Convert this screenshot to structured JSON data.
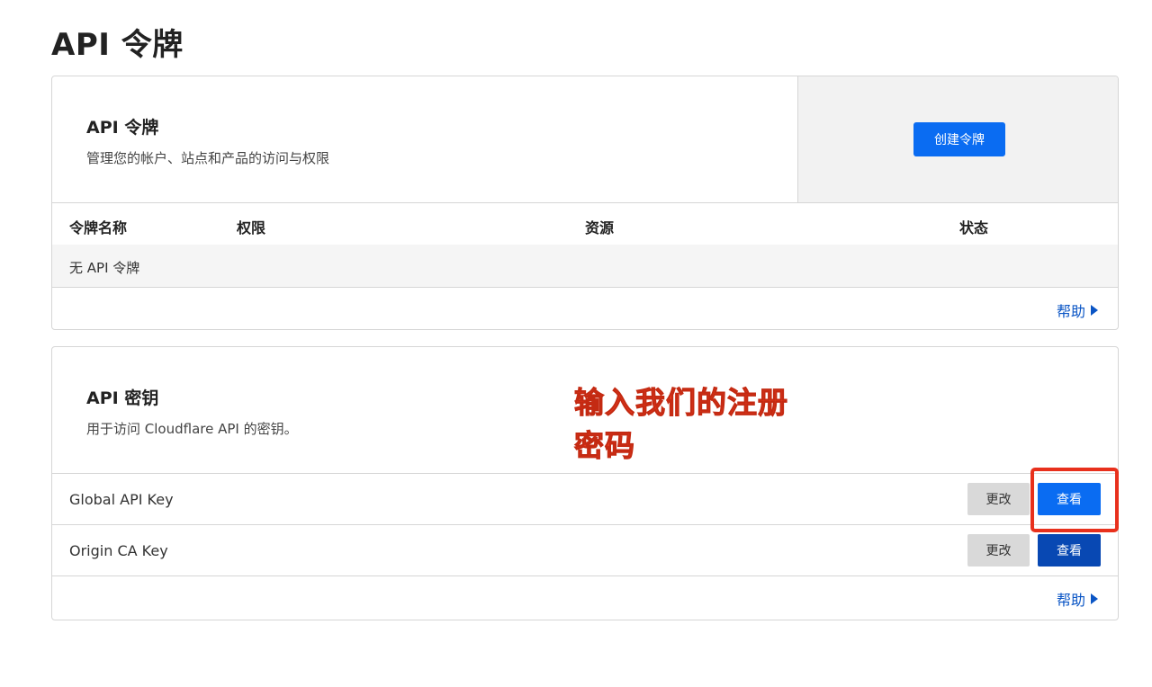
{
  "page": {
    "title": "API 令牌"
  },
  "tokens": {
    "heading": "API 令牌",
    "description": "管理您的帐户、站点和产品的访问与权限",
    "create_button": "创建令牌",
    "columns": [
      "令牌名称",
      "权限",
      "资源",
      "状态"
    ],
    "empty_message": "无 API 令牌",
    "help_link": "帮助"
  },
  "keys": {
    "heading": "API 密钥",
    "description": "用于访问 Cloudflare API 的密钥。",
    "rows": [
      {
        "name": "Global API Key",
        "change_label": "更改",
        "view_label": "查看"
      },
      {
        "name": "Origin CA Key",
        "change_label": "更改",
        "view_label": "查看"
      }
    ],
    "help_link": "帮助"
  },
  "annotation": {
    "text": "输入我们的注册密码",
    "color": "#e8391f"
  },
  "colors": {
    "primary": "#0a6cf2",
    "primary_dark": "#0848b3",
    "link": "#0a55c5",
    "highlight": "#e8301c"
  }
}
